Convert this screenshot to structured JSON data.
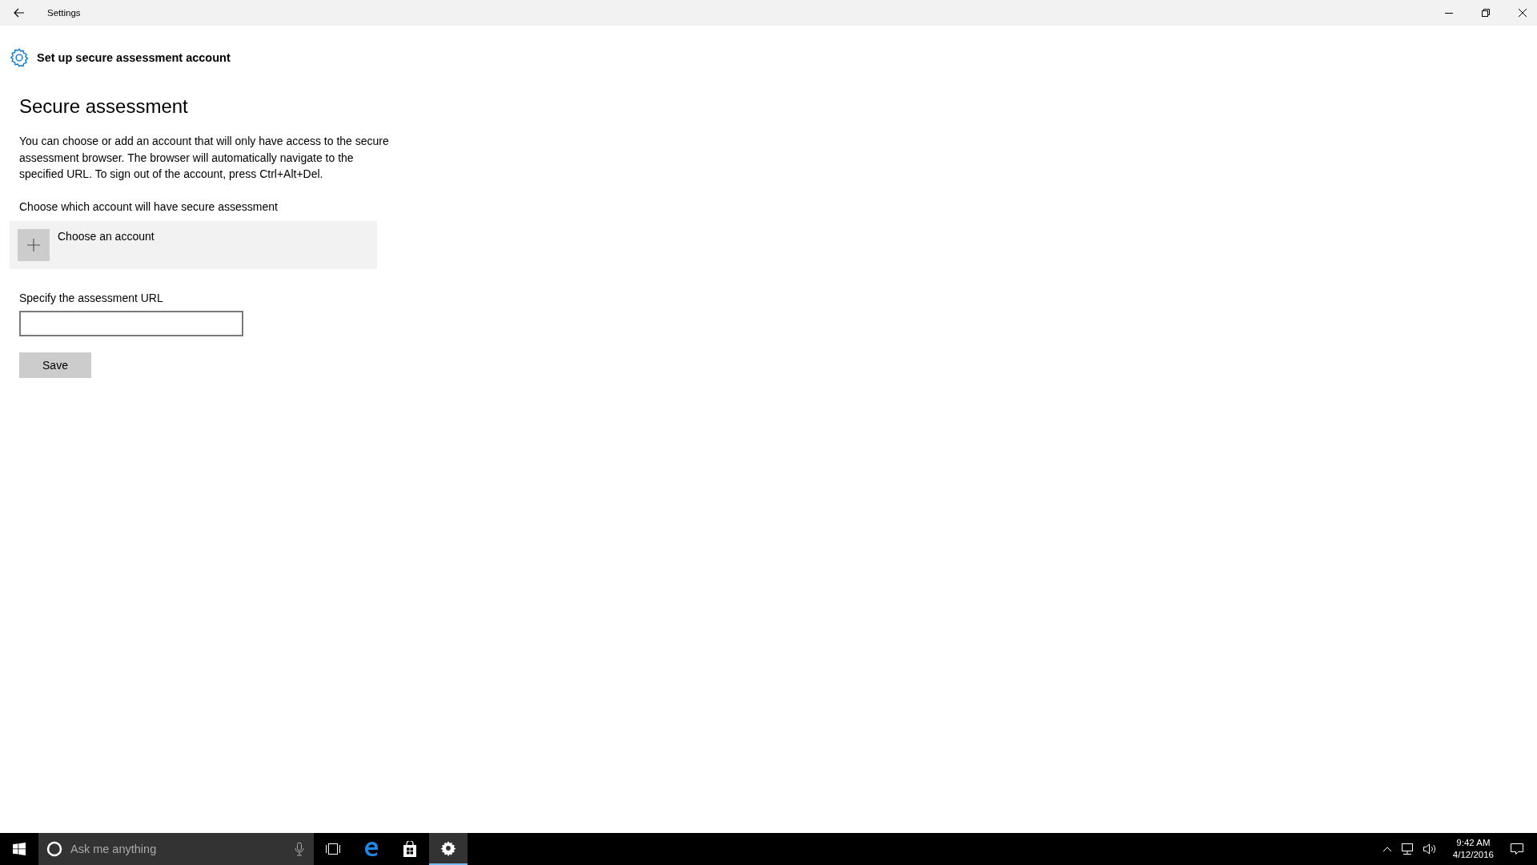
{
  "window": {
    "title": "Settings"
  },
  "page_header": {
    "title": "Set up secure assessment account"
  },
  "section": {
    "title": "Secure assessment",
    "description": "You can choose or add an account that will only have access to the secure assessment browser. The browser will automatically navigate to the specified URL. To sign out of the account, press Ctrl+Alt+Del."
  },
  "account": {
    "label": "Choose which account will have secure assessment",
    "button": "Choose an account"
  },
  "url": {
    "label": "Specify the assessment URL"
  },
  "buttons": [
    "Save"
  ],
  "taskbar": {
    "search_placeholder": "Ask me anything",
    "apps": [
      {
        "kind": "taskview",
        "selected": false
      },
      {
        "kind": "edge",
        "selected": false
      },
      {
        "kind": "store",
        "selected": false
      },
      {
        "kind": "settings",
        "selected": true
      }
    ],
    "time": "9:42 AM",
    "date": "4/12/2016"
  }
}
